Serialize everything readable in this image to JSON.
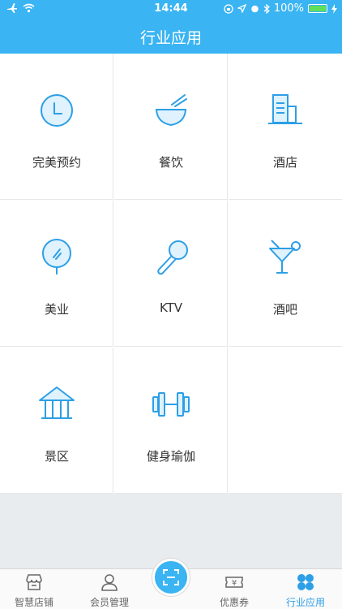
{
  "status": {
    "time": "14:44",
    "battery": "100%"
  },
  "nav": {
    "title": "行业应用"
  },
  "grid": {
    "items": [
      {
        "label": "完美预约",
        "icon": "clock-icon"
      },
      {
        "label": "餐饮",
        "icon": "bowl-chopsticks-icon"
      },
      {
        "label": "酒店",
        "icon": "hotel-building-icon"
      },
      {
        "label": "美业",
        "icon": "mirror-icon"
      },
      {
        "label": "KTV",
        "icon": "microphone-icon"
      },
      {
        "label": "酒吧",
        "icon": "cocktail-icon"
      },
      {
        "label": "景区",
        "icon": "pavilion-icon"
      },
      {
        "label": "健身瑜伽",
        "icon": "dumbbell-icon"
      }
    ]
  },
  "tabs": [
    {
      "label": "智慧店铺",
      "icon": "store-icon",
      "active": false
    },
    {
      "label": "会员管理",
      "icon": "user-icon",
      "active": false
    },
    {
      "label": "",
      "icon": "scan-icon",
      "active": false
    },
    {
      "label": "优惠券",
      "icon": "coupon-icon",
      "active": false
    },
    {
      "label": "行业应用",
      "icon": "apps-icon",
      "active": true
    }
  ],
  "colors": {
    "brand": "#3ab4f2",
    "icon_stroke": "#2d9fe6",
    "active_tab": "#2d9fe6"
  }
}
